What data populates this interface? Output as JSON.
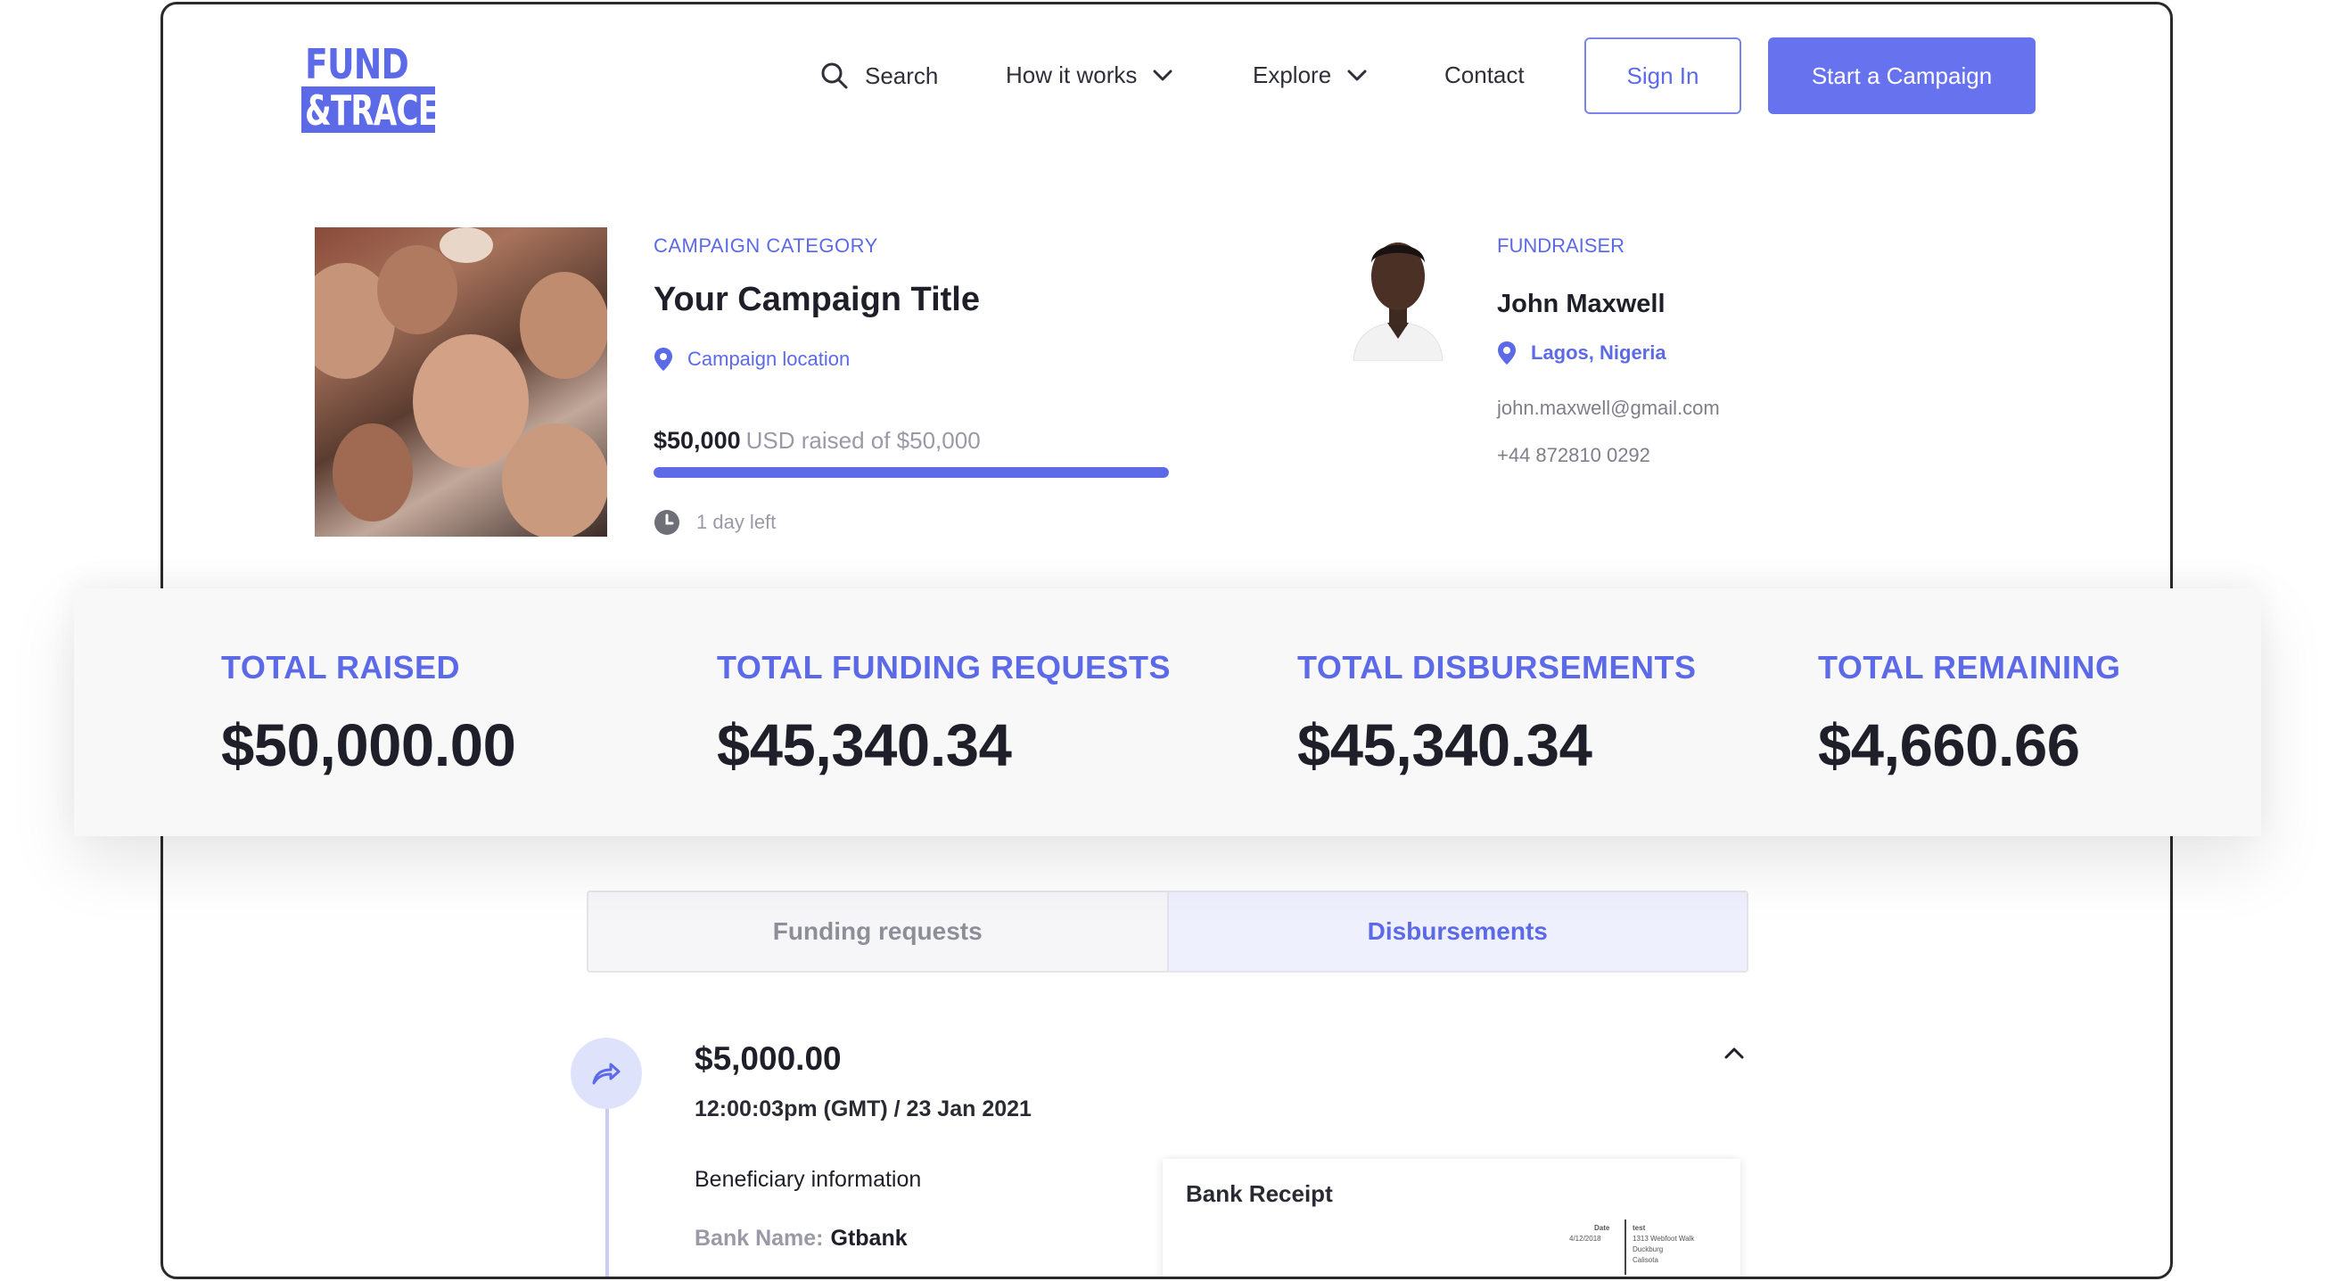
{
  "brand": {
    "line1": "FUND",
    "line2": "&TRACE",
    "color": "#5c6ae8"
  },
  "nav": {
    "search_label": "Search",
    "how_label": "How it works",
    "explore_label": "Explore",
    "contact_label": "Contact",
    "signin_label": "Sign In",
    "start_label": "Start a Campaign"
  },
  "campaign": {
    "category": "CAMPAIGN CATEGORY",
    "title": "Your Campaign Title",
    "location": "Campaign location",
    "raised_amount": "$50,000",
    "raised_text": "USD raised of $50,000",
    "progress_percent": 100,
    "time_left": "1 day left"
  },
  "fundraiser": {
    "label": "FUNDRAISER",
    "name": "John Maxwell",
    "location": "Lagos, Nigeria",
    "email": "john.maxwell@gmail.com",
    "phone": "+44 872810 0292"
  },
  "stats": [
    {
      "label": "TOTAL RAISED",
      "value": "$50,000.00"
    },
    {
      "label": "TOTAL FUNDING REQUESTS",
      "value": "$45,340.34"
    },
    {
      "label": "TOTAL DISBURSEMENTS",
      "value": "$45,340.34"
    },
    {
      "label": "TOTAL REMAINING",
      "value": "$4,660.66"
    }
  ],
  "tabs": {
    "funding_label": "Funding requests",
    "disbursements_label": "Disbursements",
    "active": "disbursements"
  },
  "disbursement": {
    "amount": "$5,000.00",
    "timestamp": "12:00:03pm (GMT) / 23 Jan 2021",
    "beneficiary_heading": "Beneficiary information",
    "bank_name_label": "Bank Name:",
    "bank_name_value": "Gtbank",
    "receipt_title": "Bank Receipt",
    "receipt_date_label": "Date",
    "receipt_date_value": "4/12/2018",
    "receipt_name": "test",
    "receipt_address_1": "1313 Webfoot Walk",
    "receipt_address_2": "Duckburg",
    "receipt_address_3": "Calisota"
  },
  "icons": {
    "search": "search-icon",
    "chevron": "chevron-down-icon",
    "pin": "map-pin-icon",
    "clock": "clock-icon",
    "share": "share-arrow-icon",
    "collapse": "chevron-up-icon"
  },
  "colors": {
    "accent": "#5c6ae8",
    "accent_light": "#eef0fd",
    "text": "#1f1f2a",
    "muted": "#9a9aa6"
  }
}
